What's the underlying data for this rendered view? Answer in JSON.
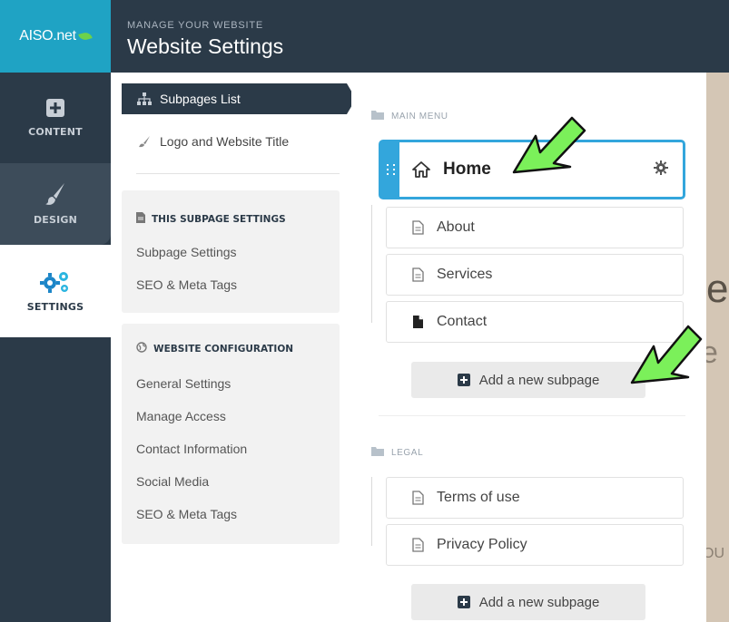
{
  "app": {
    "logo_text": "AISO.net"
  },
  "header": {
    "subtitle": "MANAGE YOUR WEBSITE",
    "title": "Website Settings"
  },
  "rail": [
    {
      "label": "CONTENT",
      "icon": "plus-square-icon"
    },
    {
      "label": "DESIGN",
      "icon": "brush-icon"
    },
    {
      "label": "SETTINGS",
      "icon": "gears-icon",
      "active": true
    }
  ],
  "menu": {
    "subpages_list": "Subpages List",
    "logo_title": "Logo and Website Title"
  },
  "subpage_settings": {
    "title": "THIS SUBPAGE SETTINGS",
    "items": [
      "Subpage Settings",
      "SEO & Meta Tags"
    ]
  },
  "website_configuration": {
    "title": "WEBSITE CONFIGURATION",
    "items": [
      "General Settings",
      "Manage Access",
      "Contact Information",
      "Social Media",
      "SEO & Meta Tags"
    ]
  },
  "sections": {
    "main_menu": {
      "label": "MAIN MENU",
      "pages": [
        "Home",
        "About",
        "Services",
        "Contact"
      ],
      "add_label": "Add a new subpage"
    },
    "legal": {
      "label": "LEGAL",
      "pages": [
        "Terms of use",
        "Privacy Policy"
      ],
      "add_label": "Add a new subpage"
    }
  },
  "colors": {
    "sidebar": "#2b3a48",
    "accent": "#33a6dc",
    "logo_bg": "#1fa3c4",
    "arrow": "#7bf05a"
  }
}
